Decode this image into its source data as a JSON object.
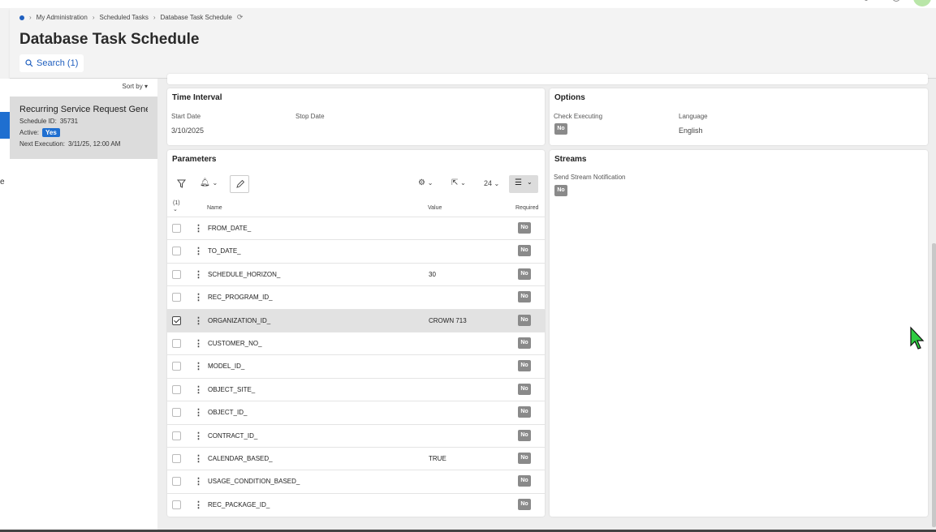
{
  "breadcrumb": {
    "items": [
      "My Administration",
      "Scheduled Tasks",
      "Database Task Schedule"
    ]
  },
  "page": {
    "title": "Database Task Schedule",
    "search_label": "Search (1)"
  },
  "list": {
    "sort_label": "Sort by",
    "record": {
      "title": "Recurring Service Request Generation",
      "schedule_id_label": "Schedule ID:",
      "schedule_id": "35731",
      "active_label": "Active:",
      "active_value": "Yes",
      "next_exec_label": "Next Execution:",
      "next_exec_value": "3/11/25, 12:00 AM"
    },
    "left_edge_letter": "e"
  },
  "time_interval": {
    "title": "Time Interval",
    "start_label": "Start Date",
    "start_value": "3/10/2025",
    "stop_label": "Stop Date",
    "stop_value": ""
  },
  "options": {
    "title": "Options",
    "check_label": "Check Executing",
    "check_value": "No",
    "language_label": "Language",
    "language_value": "English"
  },
  "streams": {
    "title": "Streams",
    "send_label": "Send Stream Notification",
    "send_value": "No"
  },
  "parameters": {
    "title": "Parameters",
    "page_size": "24",
    "selected_count": "(1)",
    "columns": {
      "name": "Name",
      "value": "Value",
      "required": "Required"
    },
    "rows": [
      {
        "name": "FROM_DATE_",
        "value": "",
        "required": "No",
        "selected": false
      },
      {
        "name": "TO_DATE_",
        "value": "",
        "required": "No",
        "selected": false
      },
      {
        "name": "SCHEDULE_HORIZON_",
        "value": "30",
        "required": "No",
        "selected": false
      },
      {
        "name": "REC_PROGRAM_ID_",
        "value": "",
        "required": "No",
        "selected": false
      },
      {
        "name": "ORGANIZATION_ID_",
        "value": "CROWN 713",
        "required": "No",
        "selected": true
      },
      {
        "name": "CUSTOMER_NO_",
        "value": "",
        "required": "No",
        "selected": false
      },
      {
        "name": "MODEL_ID_",
        "value": "",
        "required": "No",
        "selected": false
      },
      {
        "name": "OBJECT_SITE_",
        "value": "",
        "required": "No",
        "selected": false
      },
      {
        "name": "OBJECT_ID_",
        "value": "",
        "required": "No",
        "selected": false
      },
      {
        "name": "CONTRACT_ID_",
        "value": "",
        "required": "No",
        "selected": false
      },
      {
        "name": "CALENDAR_BASED_",
        "value": "TRUE",
        "required": "No",
        "selected": false
      },
      {
        "name": "USAGE_CONDITION_BASED_",
        "value": "",
        "required": "No",
        "selected": false
      },
      {
        "name": "REC_PACKAGE_ID_",
        "value": "",
        "required": "No",
        "selected": false
      }
    ]
  },
  "colors": {
    "accent": "#1f6fd0",
    "badge_no": "#8a8a8a",
    "cursor": "#2ecc40"
  }
}
